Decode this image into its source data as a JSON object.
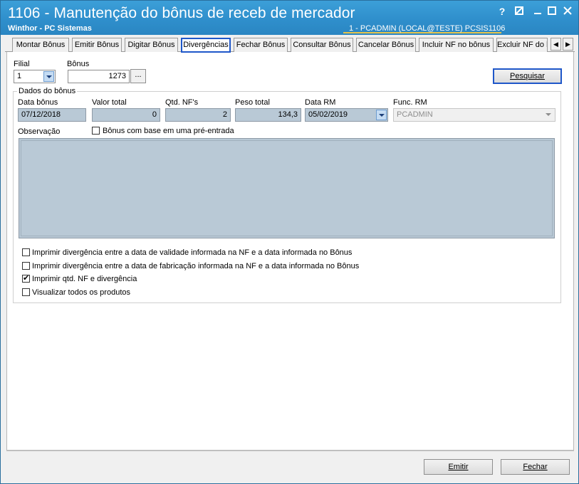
{
  "window": {
    "title": "1106 - Manutenção do bônus de receb de mercador",
    "subtitle": "Winthor - PC Sistemas",
    "user_info": "1 - PCADMIN (LOCAL@TESTE)   PCSIS1106",
    "controls": {
      "help": "?",
      "min": "—",
      "max": "☐",
      "close": "✕"
    }
  },
  "tabs": [
    {
      "label": "Montar Bônus"
    },
    {
      "label": "Emitir Bônus"
    },
    {
      "label": "Digitar Bônus"
    },
    {
      "label": "Divergências"
    },
    {
      "label": "Fechar Bônus"
    },
    {
      "label": "Consultar Bônus"
    },
    {
      "label": "Cancelar Bônus"
    },
    {
      "label": "Incluir NF no bônus"
    },
    {
      "label": "Excluir NF do bônus"
    }
  ],
  "active_tab": "Divergências",
  "filters": {
    "filial_label": "Filial",
    "filial_value": "1",
    "bonus_label": "Bônus",
    "bonus_value": "1273",
    "ellipsis": "...",
    "search_button": "Pesquisar"
  },
  "dados": {
    "group_title": "Dados do bônus",
    "data_bonus_label": "Data bônus",
    "data_bonus_value": "07/12/2018",
    "valor_total_label": "Valor total",
    "valor_total_value": "0",
    "qtd_nfs_label": "Qtd. NF's",
    "qtd_nfs_value": "2",
    "peso_total_label": "Peso total",
    "peso_total_value": "134,3",
    "data_rm_label": "Data RM",
    "data_rm_value": "05/02/2019",
    "func_rm_label": "Func. RM",
    "func_rm_value": "PCADMIN",
    "observacao_label": "Observação",
    "pre_entrada_label": "Bônus com base em uma pré-entrada",
    "pre_entrada_checked": false
  },
  "options": [
    {
      "label": "Imprimir divergência entre a data de validade informada na NF e a data informada no Bônus",
      "checked": false
    },
    {
      "label": "Imprimir divergência entre a data de fabricação informada na NF e a data informada no Bônus",
      "checked": false
    },
    {
      "label": "Imprimir qtd. NF e divergência",
      "checked": true
    },
    {
      "label": "Visualizar todos os produtos",
      "checked": false
    }
  ],
  "footer": {
    "emit_button": "Emitir",
    "close_button": "Fechar"
  },
  "colors": {
    "titlebar": "#2f8fcc",
    "readonly_field": "#b9c9d6",
    "active_tab_border": "#1f57c9"
  }
}
